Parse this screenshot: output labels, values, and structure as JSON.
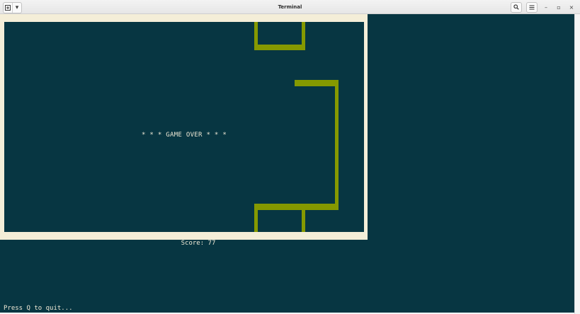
{
  "window": {
    "title": "Terminal",
    "new_tab_icon": "new-tab-icon",
    "menu_arrow": "▾",
    "search_icon": "search-icon",
    "hamburger_icon": "menu-icon",
    "minimize_glyph": "–",
    "maximize_glyph": "▫",
    "close_glyph": "×"
  },
  "game": {
    "message": "* * * GAME OVER * * *",
    "score_text": "Score: 77",
    "quit_prompt": "Press Q to quit..."
  },
  "colors": {
    "terminal_bg": "#073642",
    "terminal_fg": "#eee8d5",
    "frame": "#f4eed8",
    "snake": "#859900"
  }
}
